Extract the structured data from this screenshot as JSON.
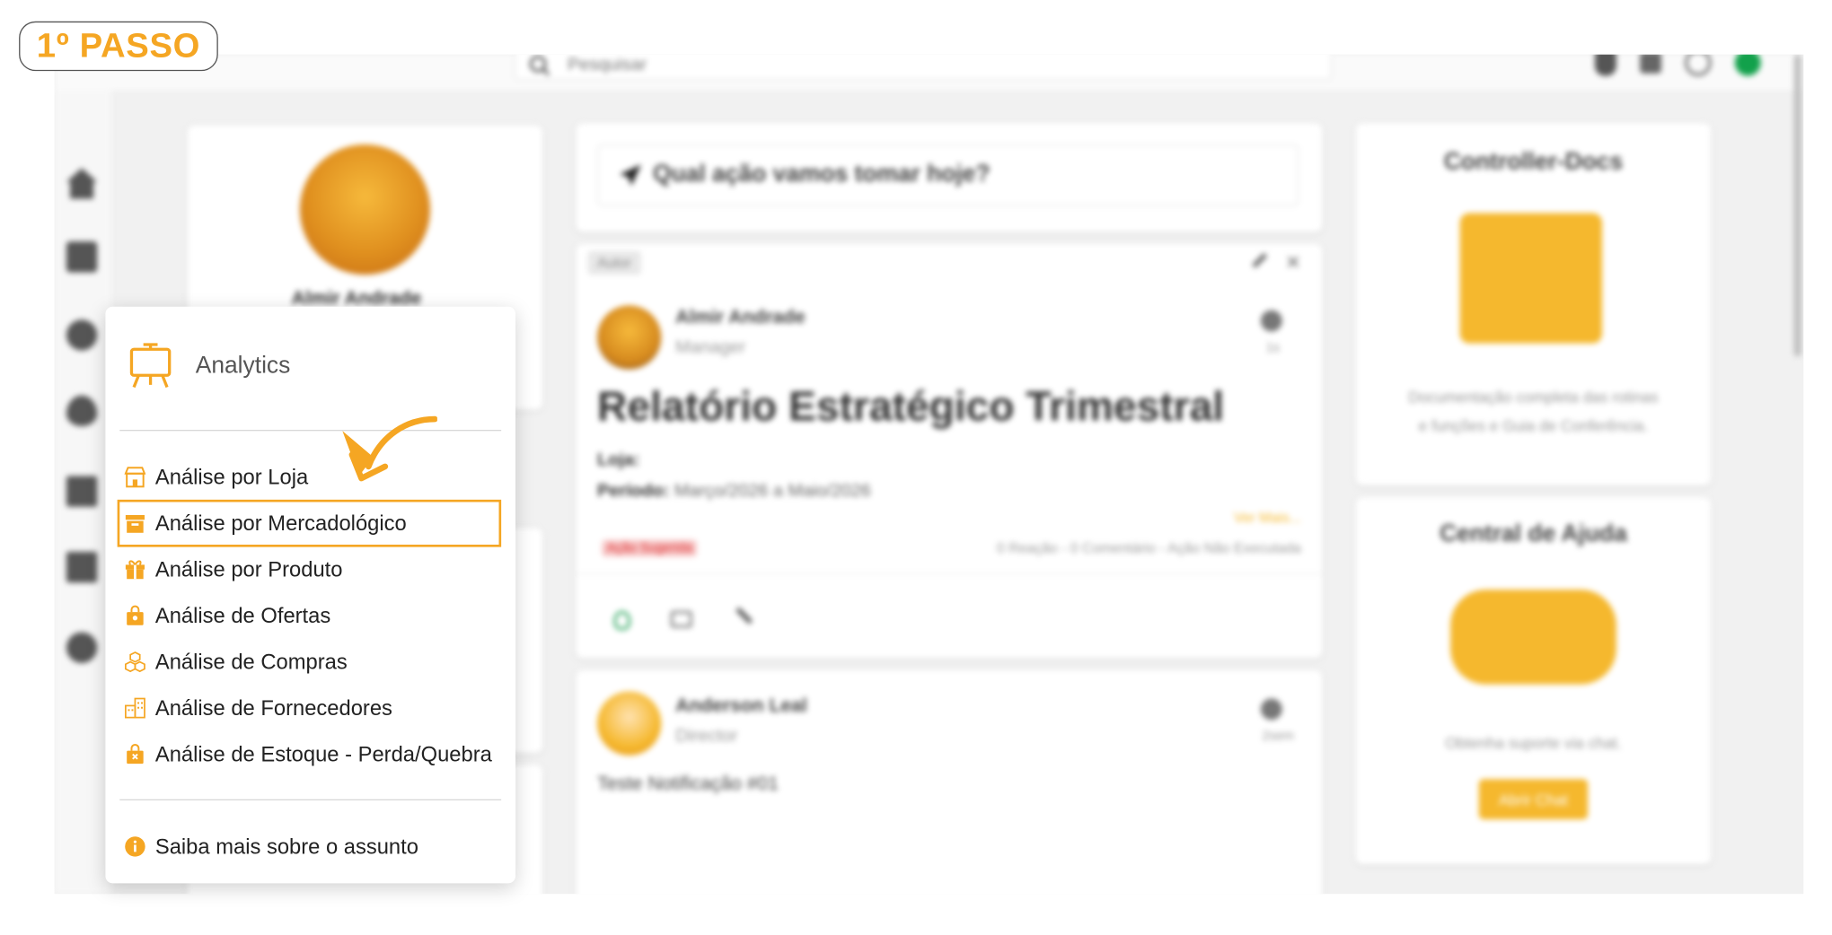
{
  "step_badge": "1º PASSO",
  "search": {
    "placeholder": "Pesquisar"
  },
  "background": {
    "profile_name": "Almir Andrade",
    "post_prompt": "Qual ação vamos tomar hoje?",
    "post1": {
      "tag": "Autor",
      "author": "Almir Andrade",
      "role": "Manager",
      "time": "1s",
      "title": "Relatório Estratégico Trimestral",
      "loja_label": "Loja:",
      "periodo_label": "Período:",
      "periodo_value": "Março/2026 a Maio/2026",
      "ver_mais": "Ver Mais...",
      "badge": "Ação Sugerida",
      "stats": "0 Reação - 0 Comentário - Ação Não Executada"
    },
    "post2": {
      "author": "Anderson Leal",
      "role": "Director",
      "time": "2sem",
      "text": "Teste Notificação #01"
    },
    "right1": {
      "title": "Controller-Docs",
      "desc_line1": "Documentação completa das rotinas",
      "desc_line2": "e funções e Guia de Conferência."
    },
    "right2": {
      "title": "Central de Ajuda",
      "desc": "Obtenha suporte via chat.",
      "button": "Abrir Chat"
    }
  },
  "menu": {
    "header": "Analytics",
    "items": [
      {
        "label": "Análise por Loja",
        "icon": "store-icon"
      },
      {
        "label": "Análise por Mercadológico",
        "icon": "box-icon"
      },
      {
        "label": "Análise por Produto",
        "icon": "gift-icon"
      },
      {
        "label": "Análise de Ofertas",
        "icon": "bag-icon"
      },
      {
        "label": "Análise de Compras",
        "icon": "boxes-icon"
      },
      {
        "label": "Análise de Fornecedores",
        "icon": "buildings-icon"
      },
      {
        "label": "Análise de Estoque - Perda/Quebra",
        "icon": "bag-x-icon"
      }
    ],
    "footer": "Saiba mais sobre o assunto"
  },
  "colors": {
    "accent": "#f5a623",
    "highlight_border": "#f5a623"
  }
}
